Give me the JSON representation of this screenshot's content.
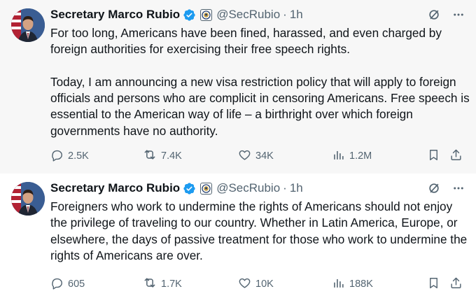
{
  "tweets": [
    {
      "author": {
        "name": "Secretary Marco Rubio",
        "handle": "@SecRubio",
        "time": "1h"
      },
      "paragraphs": [
        "For too long, Americans have been fined, harassed, and even charged by foreign authorities for exercising their free speech rights.",
        "Today, I am announcing a new visa restriction policy that will apply to foreign officials and persons who are complicit in censoring Americans. Free speech is essential to the American way of life – a birthright over which foreign governments have no authority."
      ],
      "metrics": {
        "replies": "2.5K",
        "reposts": "7.4K",
        "likes": "34K",
        "views": "1.2M"
      }
    },
    {
      "author": {
        "name": "Secretary Marco Rubio",
        "handle": "@SecRubio",
        "time": "1h"
      },
      "paragraphs": [
        "Foreigners who work to undermine the rights of Americans should not enjoy the privilege of traveling to our country.  Whether in Latin America, Europe, or elsewhere, the days of passive treatment for those who work to undermine the rights of Americans are over."
      ],
      "metrics": {
        "replies": "605",
        "reposts": "1.7K",
        "likes": "10K",
        "views": "188K"
      }
    }
  ],
  "icons": {
    "verified": "verified-badge-icon",
    "affiliation": "state-department-seal-icon",
    "grok": "grok-icon",
    "more": "more-icon",
    "reply": "reply-icon",
    "repost": "repost-icon",
    "like": "heart-icon",
    "views": "views-icon",
    "bookmark": "bookmark-icon",
    "share": "share-icon"
  },
  "colors": {
    "verified": "#1d9bf0",
    "muted": "#536471",
    "thread_line": "#cfd9de",
    "highlight_bg": "#f7f7f7"
  }
}
